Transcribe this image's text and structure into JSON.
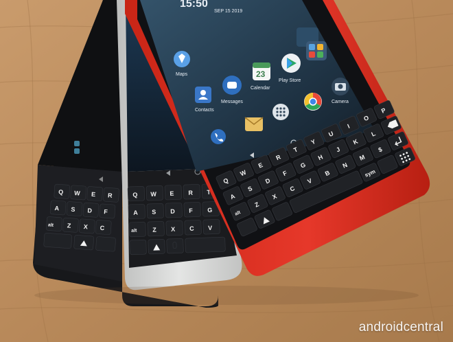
{
  "photo": {
    "subject": "Three keyboard smartphones stacked on a wooden table",
    "colors": {
      "wood": "#b98a5c",
      "red_phone": "#e0301e",
      "silver_phone": "#d6d7d6",
      "black_phone": "#1b1c1f"
    }
  },
  "red_phone": {
    "status_bar": {
      "time": "15:50",
      "date": "SEP 15 2019"
    },
    "apps": [
      {
        "label": "Maps"
      },
      {
        "label": "Calendar",
        "badge": "23"
      },
      {
        "label": "Play Store"
      },
      {
        "label": "Contacts"
      },
      {
        "label": "Messages"
      },
      {
        "label": "Camera"
      }
    ],
    "keyboard": {
      "row1": [
        "Q",
        "W",
        "E",
        "R",
        "T",
        "Y",
        "U",
        "I",
        "O",
        "P"
      ],
      "row2": [
        "A",
        "S",
        "D",
        "F",
        "G",
        "H",
        "J",
        "K",
        "L"
      ],
      "row3": [
        "alt",
        "Z",
        "X",
        "C",
        "V",
        "B",
        "N",
        "M",
        "$"
      ],
      "row4": [
        "sym"
      ]
    }
  },
  "silver_phone": {
    "keyboard": {
      "row1": [
        "Q",
        "W",
        "E",
        "R",
        "T"
      ],
      "row2": [
        "A",
        "S",
        "D",
        "F",
        "G"
      ],
      "row3": [
        "alt",
        "Z",
        "X",
        "C",
        "V"
      ]
    }
  },
  "black_phone": {
    "keyboard": {
      "row1": [
        "Q",
        "W",
        "E",
        "R"
      ],
      "row2": [
        "A",
        "S",
        "D",
        "F"
      ],
      "row3": [
        "alt",
        "Z",
        "X",
        "C"
      ]
    }
  },
  "watermark": "androidcentral"
}
